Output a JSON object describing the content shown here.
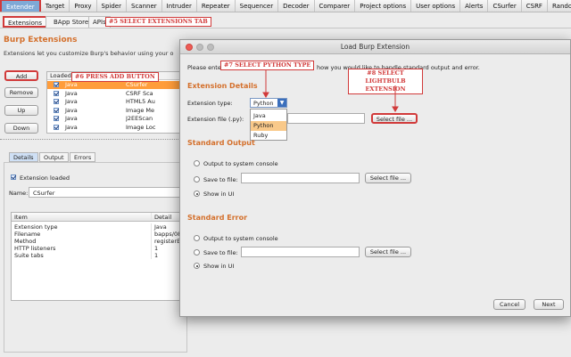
{
  "top_tabs": [
    "Extender",
    "Target",
    "Proxy",
    "Spider",
    "Scanner",
    "Intruder",
    "Repeater",
    "Sequencer",
    "Decoder",
    "Comparer",
    "Project options",
    "User options",
    "Alerts",
    "CSurfer",
    "CSRF",
    "Random He"
  ],
  "sub_tabs": [
    "Extensions",
    "BApp Store",
    "APIs"
  ],
  "annotations": {
    "select_extensions_tab": "#5 SELECT EXTENSIONS TAB",
    "press_add_button": "#6 PRESS ADD BUTTON",
    "select_python_type": "#7 SELECT PYTHON TYPE",
    "select_lightbulb": "#8 SELECT LIGHTBULB EXTENSION"
  },
  "extensions_panel": {
    "title": "Burp Extensions",
    "description": "Extensions let you customize Burp's behavior using your o",
    "buttons": {
      "add": "Add",
      "remove": "Remove",
      "up": "Up",
      "down": "Down"
    },
    "column_loaded": "Loaded",
    "column_type_partial": "e",
    "rows": [
      {
        "type": "Java",
        "name": "CSurfer",
        "selected": true
      },
      {
        "type": "Java",
        "name": "CSRF Sca"
      },
      {
        "type": "Java",
        "name": "HTML5 Au"
      },
      {
        "type": "Java",
        "name": "Image Me"
      },
      {
        "type": "Java",
        "name": "J2EEScan"
      },
      {
        "type": "Java",
        "name": "Image Loc"
      }
    ]
  },
  "lower_tabs": [
    "Details",
    "Output",
    "Errors"
  ],
  "details": {
    "extension_loaded_label": "Extension loaded",
    "name_label": "Name:",
    "name_value": "CSurfer",
    "table_headers": {
      "item": "Item",
      "detail": "Detail"
    },
    "rows": [
      {
        "item": "Extension type",
        "detail": "Java"
      },
      {
        "item": "Filename",
        "detail": "bapps/08"
      },
      {
        "item": "Method",
        "detail": "registerE"
      },
      {
        "item": "HTTP listeners",
        "detail": "1"
      },
      {
        "item": "Suite tabs",
        "detail": "1"
      }
    ]
  },
  "dialog": {
    "title": "Load Burp Extension",
    "intro_left": "Please ente",
    "intro_right": "how you would like to handle standard output and error.",
    "extension_details_title": "Extension Details",
    "extension_type_label": "Extension type:",
    "extension_type_value": "Python",
    "extension_type_options": [
      "Java",
      "Python",
      "Ruby"
    ],
    "extension_file_label": "Extension file (.py):",
    "select_file_button": "Select file ...",
    "standard_output_title": "Standard Output",
    "standard_error_title": "Standard Error",
    "radio_console": "Output to system console",
    "radio_save": "Save to file:",
    "radio_show": "Show in UI",
    "cancel": "Cancel",
    "next": "Next"
  }
}
